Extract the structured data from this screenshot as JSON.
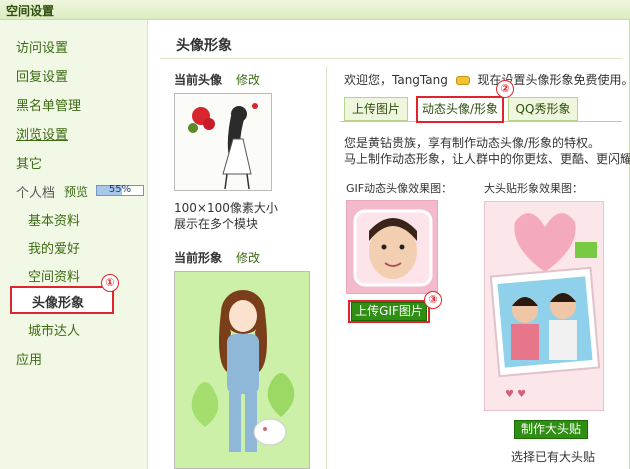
{
  "window": {
    "title": "空间设置"
  },
  "sidebar": {
    "items": [
      {
        "label": "访问设置"
      },
      {
        "label": "回复设置"
      },
      {
        "label": "黑名单管理"
      },
      {
        "label": "浏览设置"
      },
      {
        "label": "其它"
      },
      {
        "label": "个人档"
      }
    ],
    "preview_label": "预览",
    "profile_progress": {
      "text": "55%",
      "value": 0.55
    },
    "sub_items": [
      {
        "label": "基本资料"
      },
      {
        "label": "我的爱好"
      },
      {
        "label": "空间资料"
      },
      {
        "label": "头像形象"
      },
      {
        "label": "城市达人"
      }
    ],
    "app_label": "应用"
  },
  "markers": [
    "①",
    "②",
    "③"
  ],
  "main": {
    "title": "头像形象",
    "current_avatar": {
      "label": "当前头像",
      "edit": "修改",
      "caption_1": "100×100像素大小",
      "caption_2": "展示在多个模块"
    },
    "current_image": {
      "label": "当前形象",
      "edit": "修改"
    },
    "welcome": {
      "prefix": "欢迎您，TangTang",
      "suffix": "现在设置头像形象免费使用。"
    },
    "tabs": [
      {
        "label": "上传图片"
      },
      {
        "label": "动态头像/形象"
      },
      {
        "label": "QQ秀形象"
      }
    ],
    "info_line_1": "您是黄钻贵族，享有制作动态头像/形象的特权。",
    "info_line_2": "马上制作动态形象，让人群中的你更炫、更酷、更闪耀!",
    "gif_label": "GIF动态头像效果图：",
    "big_label": "大头贴形象效果图：",
    "upload_gif_button": "上传GIF图片",
    "make_big_button": "制作大头贴",
    "select_existing": "选择已有大头贴"
  },
  "colors": {
    "accent_red": "#e0242b",
    "sidebar_bg": "#f1f8e6",
    "link_green": "#3c6a12",
    "button_green": "#2e8f12"
  }
}
